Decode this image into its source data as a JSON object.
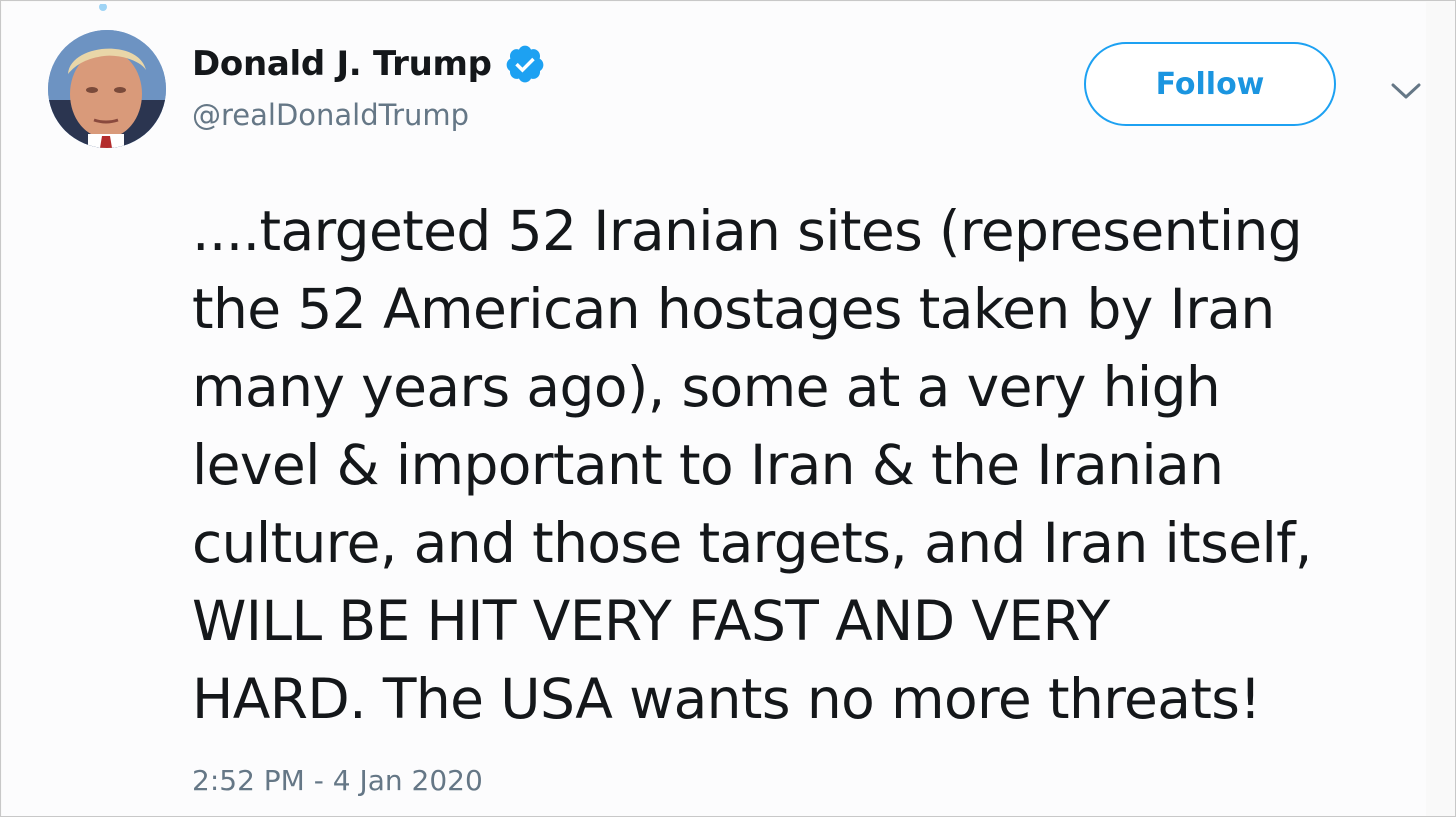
{
  "user": {
    "display_name": "Donald J. Trump",
    "handle": "@realDonaldTrump",
    "verified": true,
    "verified_color": "#1da1f2"
  },
  "actions": {
    "follow_label": "Follow",
    "more_icon": "chevron-down-icon"
  },
  "tweet": {
    "text": "....targeted 52 Iranian sites (representing\nthe 52 American hostages taken by Iran\nmany years ago), some at a very high\nlevel & important to Iran &  the Iranian\nculture, and those targets, and Iran itself,\nWILL BE HIT VERY FAST AND VERY\nHARD. The USA wants no more threats!",
    "timestamp": "2:52 PM - 4 Jan 2020"
  },
  "colors": {
    "accent": "#1da1f2",
    "text_primary": "#14171a",
    "text_secondary": "#657786"
  }
}
